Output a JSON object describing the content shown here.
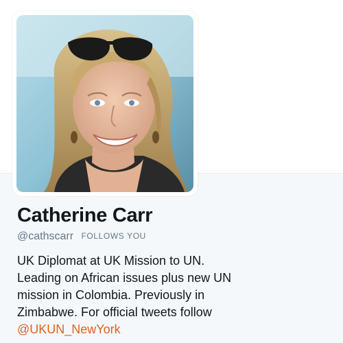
{
  "profile": {
    "name": "Catherine Carr",
    "handle": "@cathscarr",
    "follows_you": "FOLLOWS YOU",
    "bio_lines": [
      "UK Diplomat at UK Mission to UN.",
      "Leading on African issues plus new UN",
      "mission in Colombia. Previously in",
      "Zimbabwe. For official tweets follow"
    ],
    "bio_link": "@UKUN_NewYork",
    "avatar_icon": "profile-photo"
  },
  "colors": {
    "link": "#e0611f",
    "text": "#14171a",
    "secondary": "#657786",
    "background": "#f5f8fa"
  }
}
